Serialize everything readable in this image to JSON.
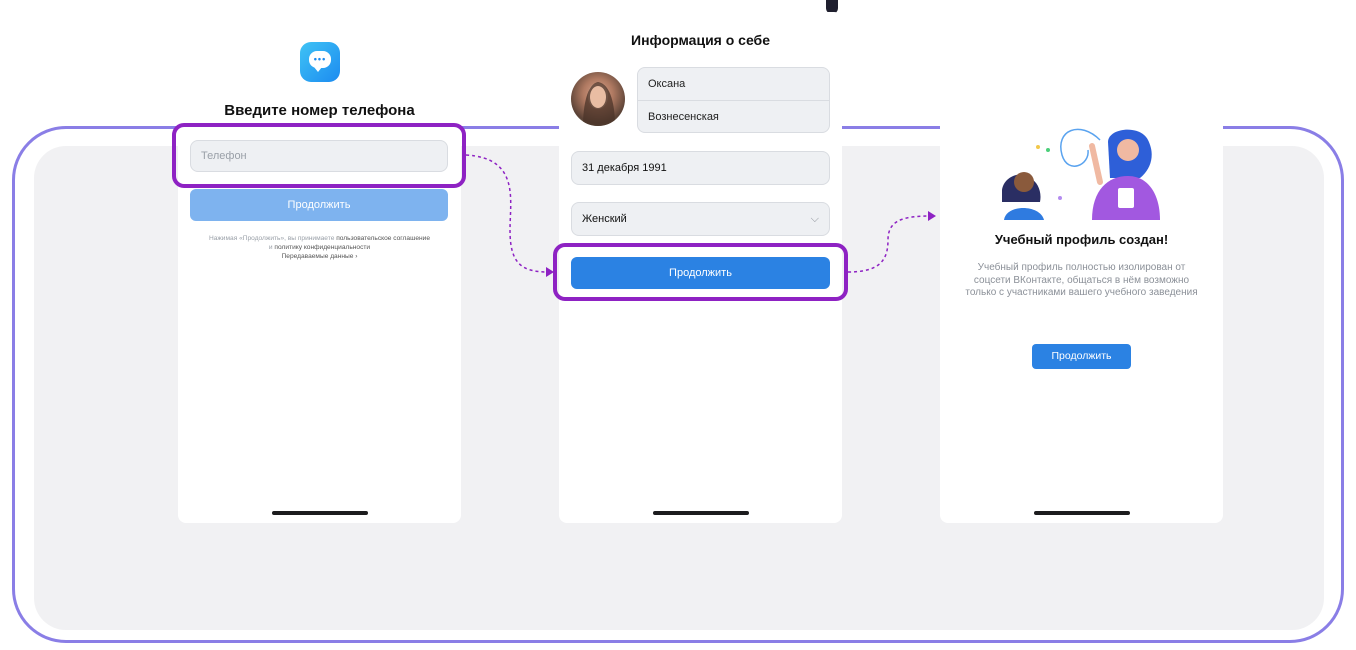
{
  "screen1": {
    "title": "Введите номер телефона",
    "phone_placeholder": "Телефон",
    "continue_label": "Продолжить",
    "terms_prefix": "Нажимая «Продолжить», вы принимаете",
    "terms_link1": "пользовательское соглашение",
    "terms_and": "и",
    "terms_link2": "политику конфиденциальности",
    "data_link": "Передаваемые данные ›"
  },
  "screen2": {
    "title": "Информация о себе",
    "first_name": "Оксана",
    "last_name": "Вознесенская",
    "birth_date": "31 декабря 1991",
    "gender": "Женский",
    "continue_label": "Продолжить"
  },
  "screen3": {
    "title": "Учебный профиль создан!",
    "description": "Учебный профиль полностью изолирован от соцсети ВКонтакте, общаться в нём возможно только с участниками вашего учебного заведения",
    "continue_label": "Продолжить"
  },
  "colors": {
    "accent": "#2b82e3",
    "accent_disabled": "#7eb3ef",
    "highlight": "#8e22c3",
    "frame": "#8a7ee6",
    "panel": "#f1f1f3"
  },
  "icons": [
    "vk-messenger-logo-icon",
    "chevron-down-icon",
    "user-avatar-photo"
  ]
}
